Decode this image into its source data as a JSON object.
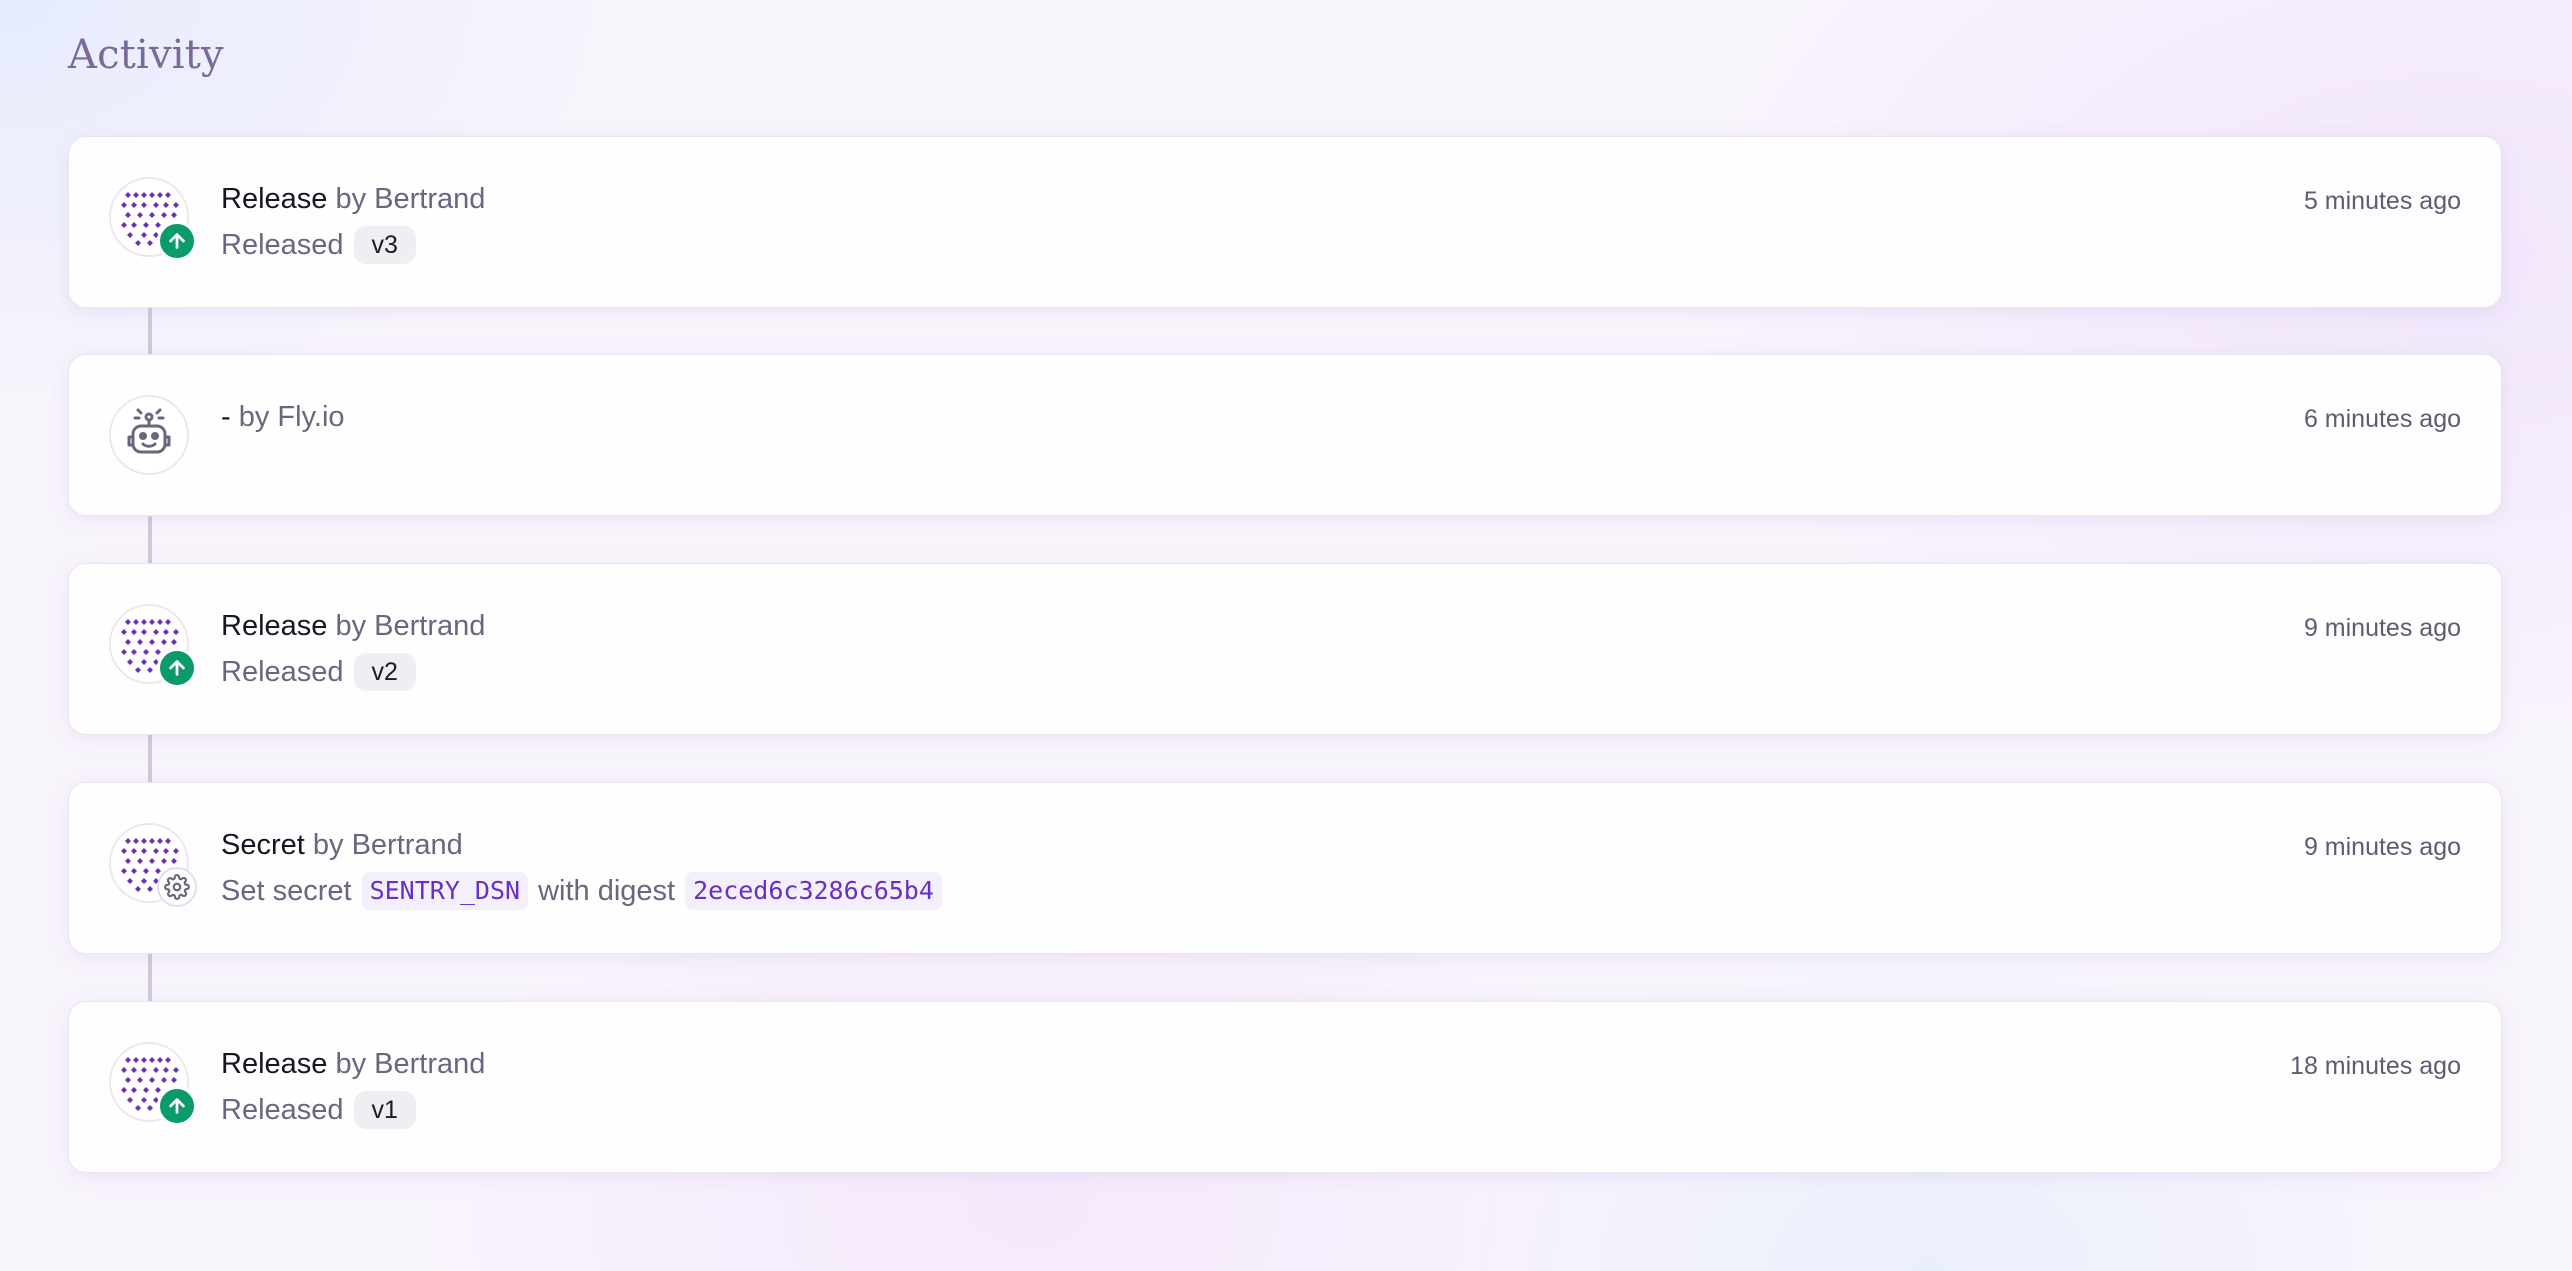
{
  "page": {
    "title": "Activity"
  },
  "colors": {
    "accent": "#6a2ec8",
    "release_badge": "#0b9a6b",
    "title": "#7a6a9a"
  },
  "activities": [
    {
      "kind": "Release",
      "actor": "by Bertrand",
      "time": "5 minutes ago",
      "detail_prefix": "Released",
      "version": "v3",
      "avatar_icon": "user-identicon",
      "badge_icon": "arrow-up-icon"
    },
    {
      "kind": "-",
      "actor": "by Fly.io",
      "time": "6 minutes ago",
      "avatar_icon": "robot-icon"
    },
    {
      "kind": "Release",
      "actor": "by Bertrand",
      "time": "9 minutes ago",
      "detail_prefix": "Released",
      "version": "v2",
      "avatar_icon": "user-identicon",
      "badge_icon": "arrow-up-icon"
    },
    {
      "kind": "Secret",
      "actor": "by Bertrand",
      "time": "9 minutes ago",
      "detail_prefix": "Set secret",
      "secret_name": "SENTRY_DSN",
      "detail_middle": "with digest",
      "digest": "2eced6c3286c65b4",
      "avatar_icon": "user-identicon",
      "badge_icon": "gear-icon"
    },
    {
      "kind": "Release",
      "actor": "by Bertrand",
      "time": "18 minutes ago",
      "detail_prefix": "Released",
      "version": "v1",
      "avatar_icon": "user-identicon",
      "badge_icon": "arrow-up-icon"
    }
  ]
}
